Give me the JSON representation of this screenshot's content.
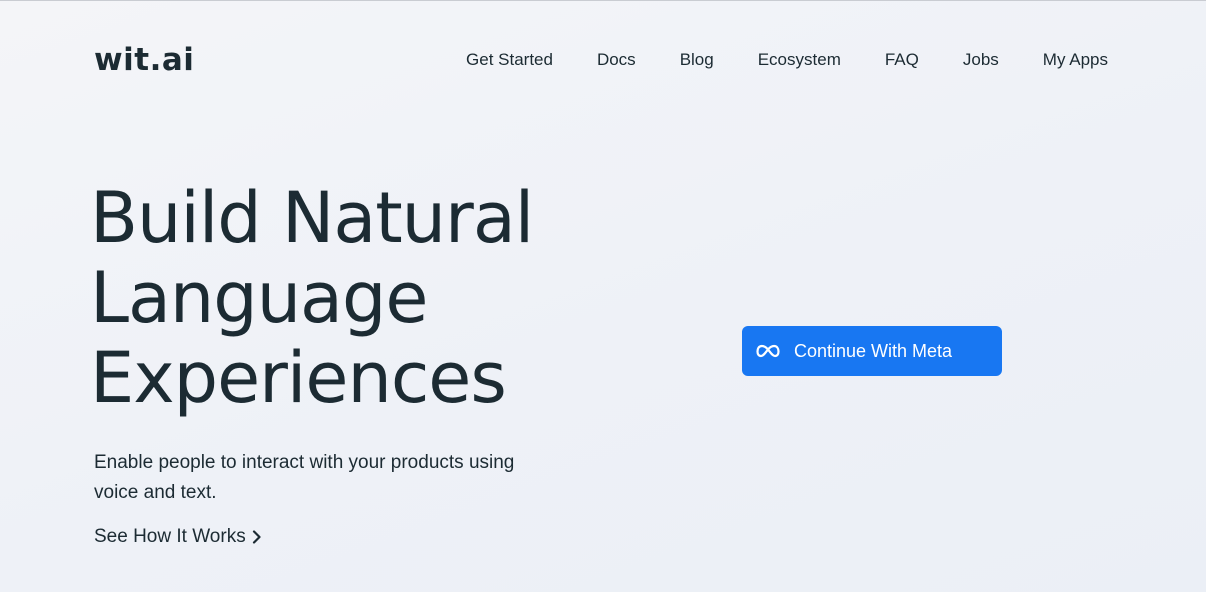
{
  "brand": {
    "logo_text": "wit.ai"
  },
  "nav": {
    "items": [
      {
        "label": "Get Started"
      },
      {
        "label": "Docs"
      },
      {
        "label": "Blog"
      },
      {
        "label": "Ecosystem"
      },
      {
        "label": "FAQ"
      },
      {
        "label": "Jobs"
      },
      {
        "label": "My Apps"
      }
    ]
  },
  "hero": {
    "title_lines": [
      "Build Natural",
      "Language",
      "Experiences"
    ],
    "subtitle": "Enable people to interact with your products using voice and text.",
    "see_how_label": "See How It Works"
  },
  "cta": {
    "label": "Continue With Meta",
    "icon": "meta-infinity-icon",
    "color": "#1877f2"
  },
  "colors": {
    "text": "#1c2b33",
    "background": "#eef1f7"
  }
}
